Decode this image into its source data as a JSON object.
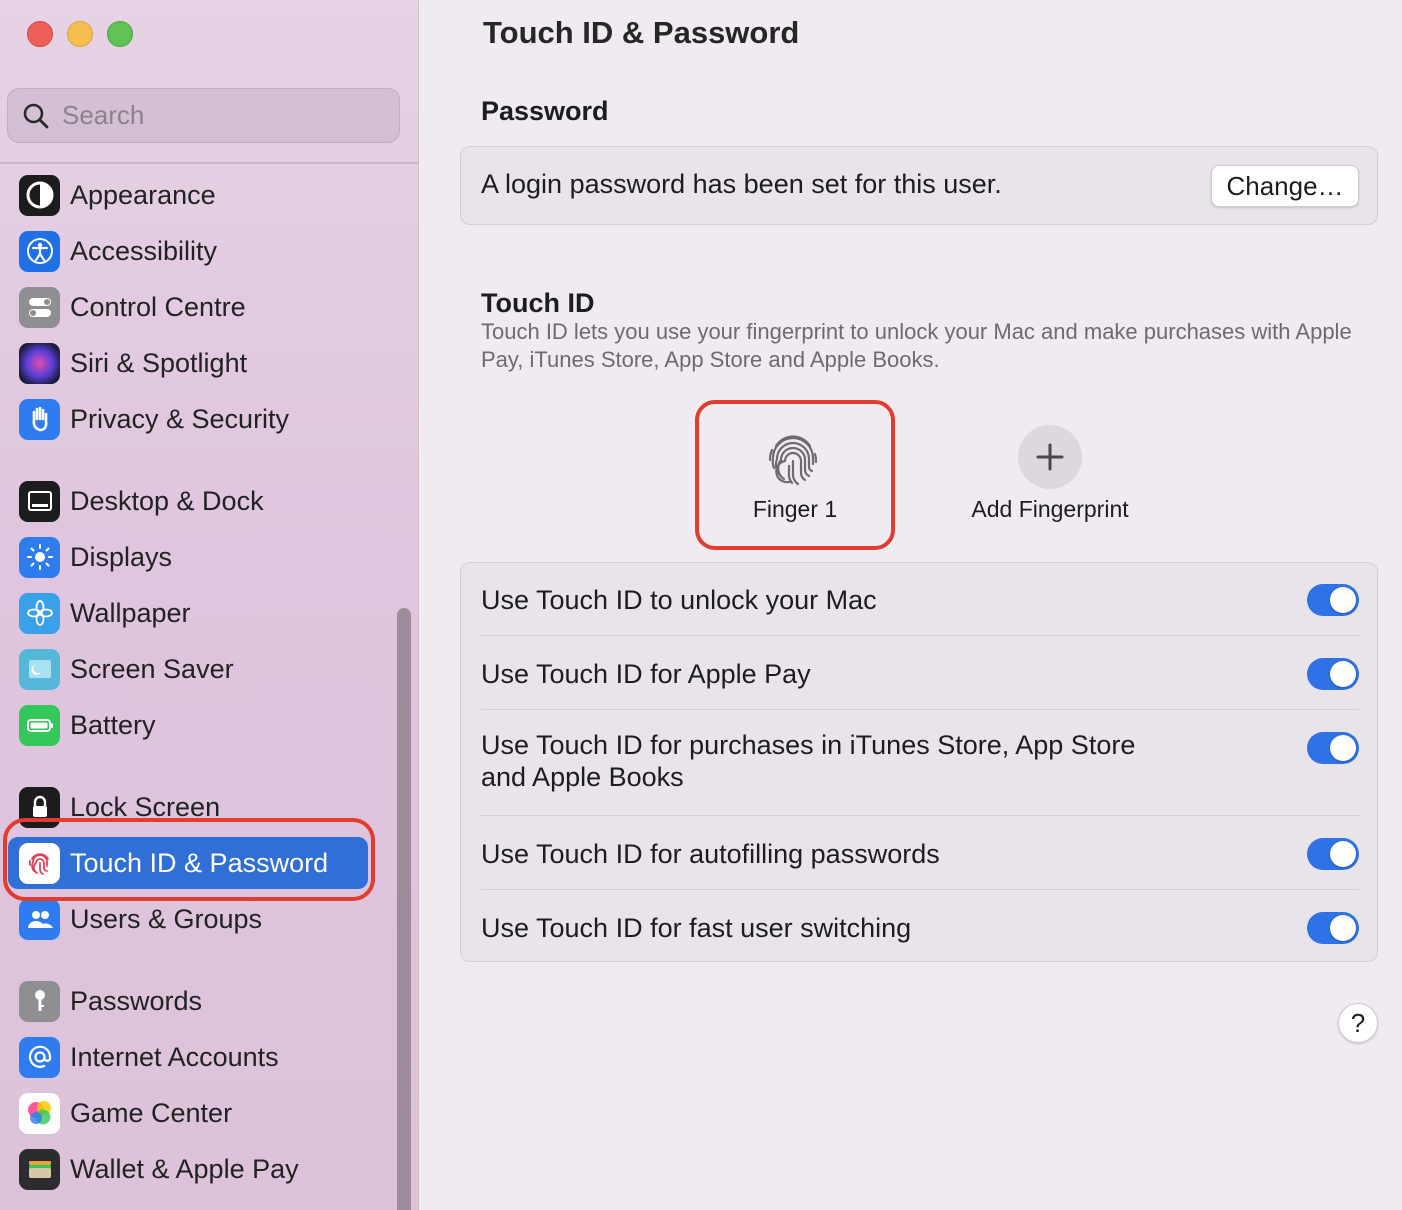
{
  "window": {
    "title": "Touch ID & Password"
  },
  "search": {
    "placeholder": "Search"
  },
  "sidebar": {
    "items": [
      {
        "label": "Appearance",
        "icon": "appearance-icon",
        "color": "#1c1c1e"
      },
      {
        "label": "Accessibility",
        "icon": "accessibility-icon",
        "color": "#1f6fe5"
      },
      {
        "label": "Control Centre",
        "icon": "control-centre-icon",
        "color": "#8e8e93"
      },
      {
        "label": "Siri & Spotlight",
        "icon": "siri-icon",
        "color": "#2a2a55"
      },
      {
        "label": "Privacy & Security",
        "icon": "hand-icon",
        "color": "#2f7cf0"
      },
      {
        "label": "Desktop & Dock",
        "icon": "dock-icon",
        "color": "#1c1c1e"
      },
      {
        "label": "Displays",
        "icon": "sun-icon",
        "color": "#2f7cf0"
      },
      {
        "label": "Wallpaper",
        "icon": "flower-icon",
        "color": "#3aa0e8"
      },
      {
        "label": "Screen Saver",
        "icon": "screen-saver-icon",
        "color": "#56b8d8"
      },
      {
        "label": "Battery",
        "icon": "battery-icon",
        "color": "#34c759"
      },
      {
        "label": "Lock Screen",
        "icon": "lock-icon",
        "color": "#1c1c1e"
      },
      {
        "label": "Touch ID & Password",
        "icon": "fingerprint-icon",
        "color": "#ffffff"
      },
      {
        "label": "Users & Groups",
        "icon": "users-icon",
        "color": "#2f7cf0"
      },
      {
        "label": "Passwords",
        "icon": "key-icon",
        "color": "#8e8e93"
      },
      {
        "label": "Internet Accounts",
        "icon": "at-icon",
        "color": "#2f7cf0"
      },
      {
        "label": "Game Center",
        "icon": "game-center-icon",
        "color": "#ffffff"
      },
      {
        "label": "Wallet & Apple Pay",
        "icon": "wallet-icon",
        "color": "#2c2c2e"
      }
    ],
    "selected": "Touch ID & Password"
  },
  "main": {
    "title": "Touch ID & Password",
    "password": {
      "heading": "Password",
      "status": "A login password has been set for this user.",
      "change_label": "Change…"
    },
    "touch_id": {
      "heading": "Touch ID",
      "description": "Touch ID lets you use your fingerprint to unlock your Mac and make purchases with Apple Pay, iTunes Store, App Store and Apple Books.",
      "finger_label": "Finger 1",
      "add_label": "Add Fingerprint"
    },
    "options": [
      {
        "label": "Use Touch ID to unlock your Mac",
        "on": true
      },
      {
        "label": "Use Touch ID for Apple Pay",
        "on": true
      },
      {
        "label": "Use Touch ID for purchases in iTunes Store, App Store and Apple Books",
        "on": true
      },
      {
        "label": "Use Touch ID for autofilling passwords",
        "on": true
      },
      {
        "label": "Use Touch ID for fast user switching",
        "on": true
      }
    ],
    "help_label": "?"
  },
  "colors": {
    "accent": "#2f72e6",
    "highlight": "#e23b2f"
  }
}
